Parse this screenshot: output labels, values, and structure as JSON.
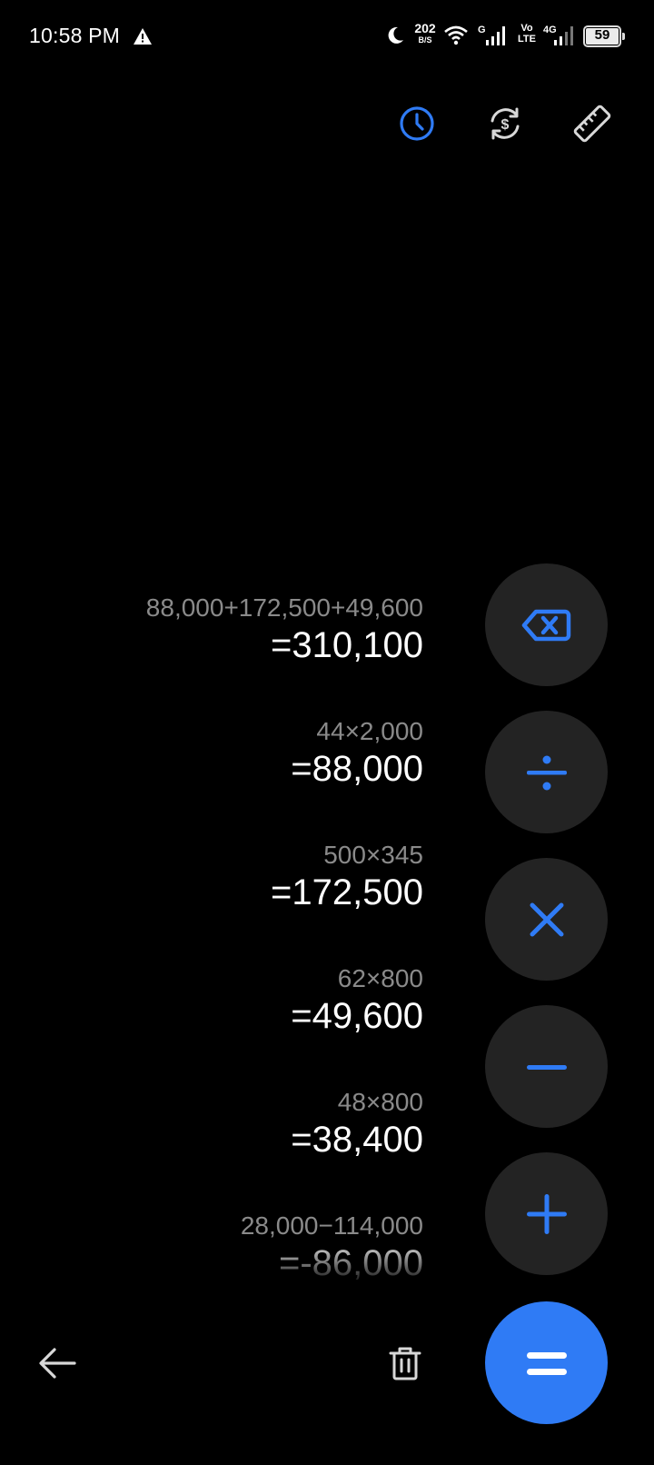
{
  "status_bar": {
    "time": "10:58 PM",
    "net_speed_value": "202",
    "net_speed_unit": "B/S",
    "network1_label": "G",
    "volte_top": "Vo",
    "volte_bottom": "LTE",
    "network2_label": "4G",
    "battery": "59"
  },
  "toolbar": {
    "icons": [
      "history-icon",
      "currency-convert-icon",
      "ruler-icon"
    ],
    "active_color": "#2f7bf5"
  },
  "history": [
    {
      "expression": "88,000+172,500+49,600",
      "result": "=310,100"
    },
    {
      "expression": "44×2,000",
      "result": "=88,000"
    },
    {
      "expression": "500×345",
      "result": "=172,500"
    },
    {
      "expression": "62×800",
      "result": "=49,600"
    },
    {
      "expression": "48×800",
      "result": "=38,400"
    },
    {
      "expression": "28,000−114,000",
      "result": "=-86,000"
    }
  ],
  "operators": [
    "backspace-icon",
    "divide-icon",
    "multiply-icon",
    "minus-icon",
    "plus-icon",
    "equals-icon"
  ],
  "colors": {
    "accent": "#2f7bf5",
    "button_bg": "#232323",
    "expression_text": "#8a8a8a"
  }
}
